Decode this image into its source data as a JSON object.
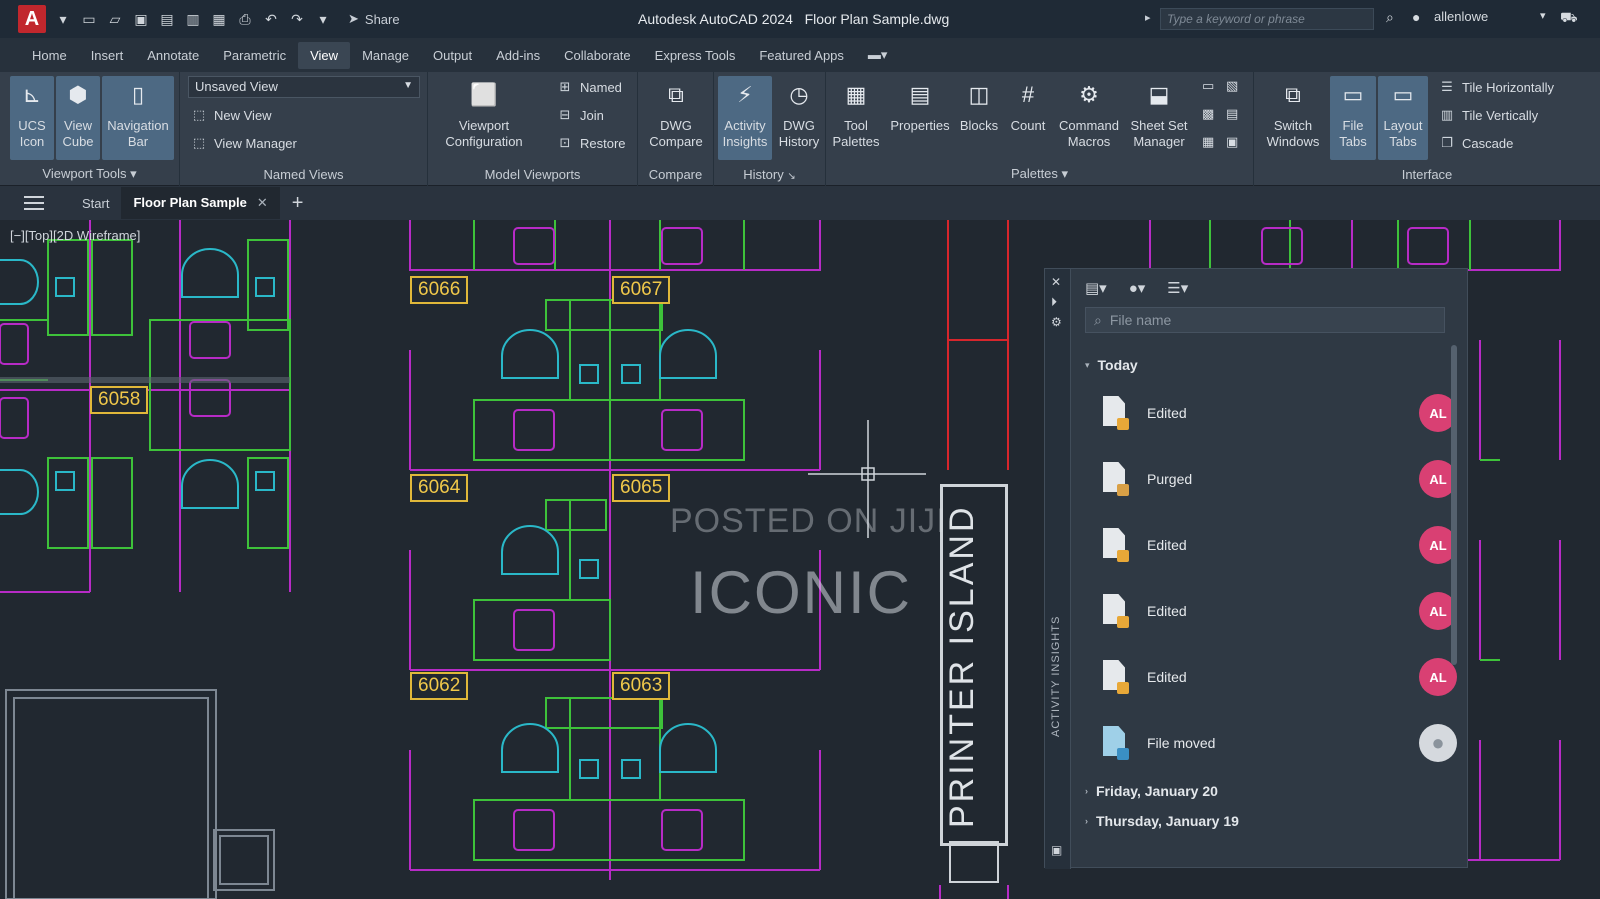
{
  "app": {
    "title": "Autodesk AutoCAD 2024",
    "filename": "Floor Plan Sample.dwg",
    "share_label": "Share",
    "search_placeholder": "Type a keyword or phrase",
    "user": "allenlowe"
  },
  "menu": {
    "tabs": [
      "Home",
      "Insert",
      "Annotate",
      "Parametric",
      "View",
      "Manage",
      "Output",
      "Add-ins",
      "Collaborate",
      "Express Tools",
      "Featured Apps"
    ],
    "active": "View"
  },
  "ribbon": {
    "viewport_tools": {
      "label": "Viewport Tools",
      "ucs_icon": "UCS Icon",
      "view_cube": "View Cube",
      "navigation_bar": "Navigation Bar"
    },
    "named_views": {
      "label": "Named Views",
      "dropdown_value": "Unsaved View",
      "new_view": "New View",
      "view_manager": "View Manager"
    },
    "model_viewports": {
      "label": "Model Viewports",
      "viewport_configuration": "Viewport Configuration",
      "named": "Named",
      "join": "Join",
      "restore": "Restore"
    },
    "compare": {
      "label": "Compare",
      "dwg_compare": "DWG Compare"
    },
    "history": {
      "label": "History",
      "activity_insights": "Activity Insights",
      "dwg_history": "DWG History"
    },
    "palettes": {
      "label": "Palettes",
      "tool_palettes": "Tool Palettes",
      "properties": "Properties",
      "blocks": "Blocks",
      "count": "Count",
      "command_macros": "Command Macros",
      "sheet_set_manager": "Sheet Set Manager"
    },
    "interface": {
      "label": "Interface",
      "switch_windows": "Switch Windows",
      "file_tabs": "File Tabs",
      "layout_tabs": "Layout Tabs",
      "tile_horizontally": "Tile Horizontally",
      "tile_vertically": "Tile Vertically",
      "cascade": "Cascade"
    }
  },
  "doc_tabs": {
    "start": "Start",
    "active": "Floor Plan Sample"
  },
  "viewport": {
    "label": "[−][Top][2D Wireframe]"
  },
  "drawing": {
    "rooms": [
      "6066",
      "6067",
      "6058",
      "6064",
      "6065",
      "6062",
      "6063"
    ],
    "printer_island": "PRINTER ISLAND",
    "watermark_line1": "POSTED ON JIJI",
    "watermark_line2": "ICONIC"
  },
  "activity_insights": {
    "strip_title": "ACTIVITY INSIGHTS",
    "search_placeholder": "File name",
    "group_today": "Today",
    "events": [
      {
        "label": "Edited",
        "initials": "AL",
        "icon": "edit-file-icon"
      },
      {
        "label": "Purged",
        "initials": "AL",
        "icon": "purge-file-icon"
      },
      {
        "label": "Edited",
        "initials": "AL",
        "icon": "edit-file-icon"
      },
      {
        "label": "Edited",
        "initials": "AL",
        "icon": "edit-file-icon"
      },
      {
        "label": "Edited",
        "initials": "AL",
        "icon": "edit-file-icon"
      },
      {
        "label": "File moved",
        "initials": "",
        "icon": "move-file-icon"
      }
    ],
    "group_friday": "Friday, January 20",
    "group_thursday": "Thursday, January 19"
  },
  "colors": {
    "wall": "#b72bc6",
    "furniture": "#3ec23a",
    "chair": "#2ab8c8",
    "room_tag": "#e0b83a",
    "name_text": "#d7262c",
    "avatar": "#d94073"
  }
}
